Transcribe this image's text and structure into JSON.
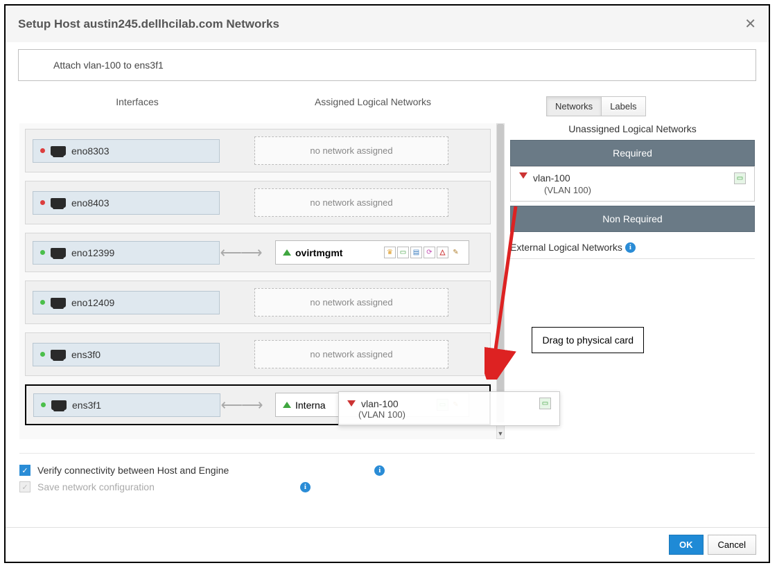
{
  "dialog": {
    "title": "Setup Host austin245.dellhcilab.com Networks",
    "instruction": "Attach vlan-100 to ens3f1"
  },
  "headers": {
    "interfaces": "Interfaces",
    "assigned": "Assigned Logical Networks"
  },
  "tabs": {
    "networks": "Networks",
    "labels": "Labels"
  },
  "interfaces": [
    {
      "name": "eno8303",
      "status": "red",
      "bonded": false,
      "network": null
    },
    {
      "name": "eno8403",
      "status": "red",
      "bonded": false,
      "network": null
    },
    {
      "name": "eno12399",
      "status": "green",
      "bonded": true,
      "network": {
        "label": "ovirtmgmt",
        "dir": "up",
        "icons": [
          "crown",
          "mon",
          "net",
          "sync",
          "warn",
          "edit"
        ]
      }
    },
    {
      "name": "eno12409",
      "status": "green",
      "bonded": false,
      "network": null
    },
    {
      "name": "ens3f0",
      "status": "green",
      "bonded": false,
      "network": null
    },
    {
      "name": "ens3f1",
      "status": "green",
      "bonded": true,
      "dropTarget": true,
      "network": {
        "label": "Interna",
        "dir": "up",
        "icons": [
          "vm",
          "edit"
        ]
      }
    }
  ],
  "no_network_label": "no network assigned",
  "right": {
    "unassigned_title": "Unassigned Logical Networks",
    "required_label": "Required",
    "non_required_label": "Non Required",
    "external_label": "External Logical Networks",
    "unassigned": [
      {
        "name": "vlan-100",
        "sub": "(VLAN 100)",
        "dir": "down"
      }
    ]
  },
  "drag_ghost": {
    "name": "vlan-100",
    "sub": "(VLAN 100)"
  },
  "annotation": "Drag to physical card",
  "options": {
    "verify": "Verify connectivity between Host and Engine",
    "save": "Save network configuration"
  },
  "buttons": {
    "ok": "OK",
    "cancel": "Cancel"
  }
}
